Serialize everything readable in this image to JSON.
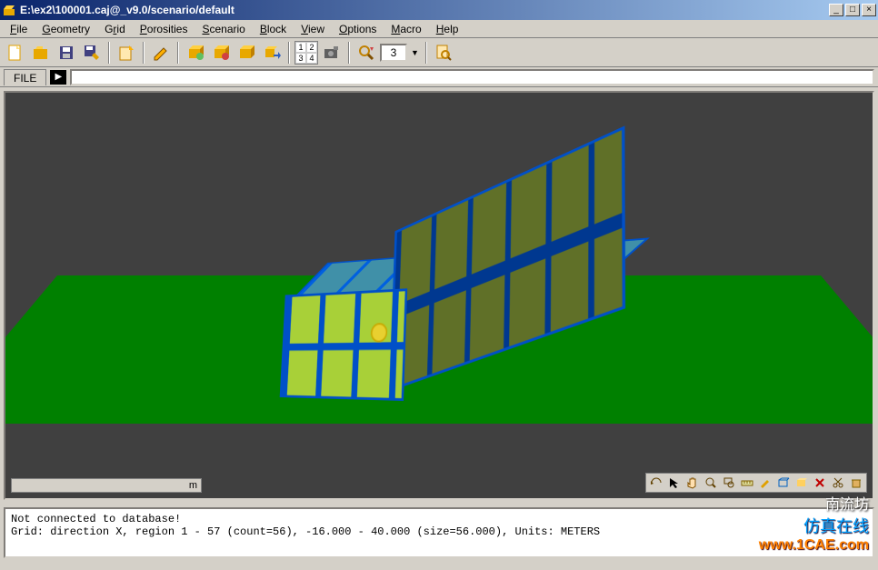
{
  "window": {
    "title": "E:\\ex2\\100001.caj@_v9.0/scenario/default"
  },
  "menu": {
    "items": [
      {
        "label": "File",
        "u": 0
      },
      {
        "label": "Geometry",
        "u": 0
      },
      {
        "label": "Grid",
        "u": 1
      },
      {
        "label": "Porosities",
        "u": 0
      },
      {
        "label": "Scenario",
        "u": 0
      },
      {
        "label": "Block",
        "u": 0
      },
      {
        "label": "View",
        "u": 0
      },
      {
        "label": "Options",
        "u": 0
      },
      {
        "label": "Macro",
        "u": 0
      },
      {
        "label": "Help",
        "u": 0
      }
    ]
  },
  "toolbar": {
    "numValue": "3"
  },
  "cmdbar": {
    "tab": "FILE",
    "input": ""
  },
  "scalebar": {
    "unit": "m"
  },
  "status": {
    "line1": "Not connected to database!",
    "line2": "",
    "line3": "Grid: direction X, region 1 - 57 (count=56), -16.000 - 40.000 (size=56.000), Units: METERS"
  },
  "watermark": {
    "l1": "南流坊",
    "l2": "仿真在线",
    "l3": "www.1CAE.com"
  }
}
